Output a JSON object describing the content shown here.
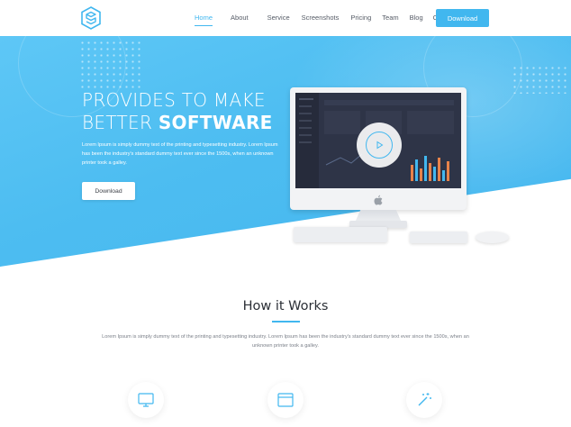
{
  "header": {
    "logo_name": "cube-logo-icon",
    "nav": [
      {
        "label": "Home",
        "active": true
      },
      {
        "label": "About",
        "active": false
      },
      {
        "label": "Service",
        "active": false
      },
      {
        "label": "Screenshots",
        "active": false
      },
      {
        "label": "Pricing",
        "active": false
      },
      {
        "label": "Team",
        "active": false
      },
      {
        "label": "Blog",
        "active": false
      },
      {
        "label": "Contact",
        "active": false
      }
    ],
    "download_label": "Download"
  },
  "hero": {
    "title_line1": "PROVIDES TO MAKE",
    "title_line2_light": "BETTER",
    "title_line2_bold": "SOFTWARE",
    "description": "Lorem Ipsum is simply dummy text of the printing and typesetting industry. Lorem Ipsum has been the industry's standard dummy text ever since the 1500s, when an unknown printer took a galley.",
    "button_label": "Download"
  },
  "how_it_works": {
    "title": "How it Works",
    "description": "Lorem Ipsum is simply dummy text of the printing and typesetting industry. Lorem Ipsum has been the industry's standard dummy text ever since the 1500s, when an unknown printer took a galley.",
    "features": [
      {
        "icon": "monitor-icon"
      },
      {
        "icon": "browser-window-icon"
      },
      {
        "icon": "magic-wand-icon"
      }
    ]
  },
  "colors": {
    "accent": "#41b7ef",
    "hero_background": "#4dbdf1",
    "text_dark": "#2b2f36",
    "text_muted": "#7a7f88"
  }
}
